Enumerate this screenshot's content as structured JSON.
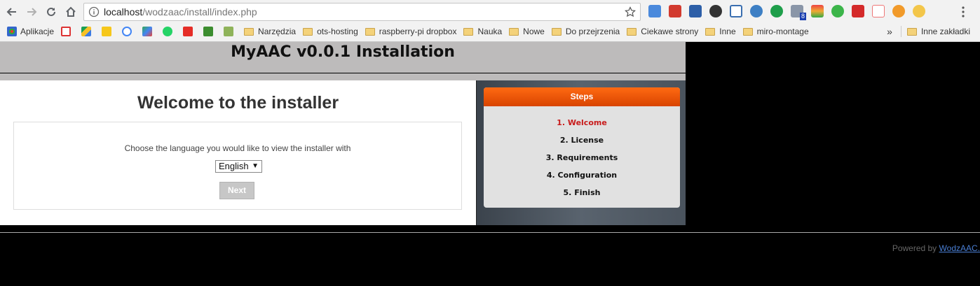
{
  "browser": {
    "url_host": "localhost",
    "url_path": "/wodzaac/install/index.php",
    "bookmarks": [
      {
        "label": "Aplikacje",
        "type": "apps"
      },
      {
        "label": "",
        "type": "gmail"
      },
      {
        "label": "",
        "type": "drive"
      },
      {
        "label": "",
        "type": "keep"
      },
      {
        "label": "",
        "type": "google"
      },
      {
        "label": "",
        "type": "maps"
      },
      {
        "label": "",
        "type": "whatsapp"
      },
      {
        "label": "",
        "type": "youtube"
      },
      {
        "label": "",
        "type": "feedly"
      },
      {
        "label": "",
        "type": "evernote"
      },
      {
        "label": "Narzędzia",
        "type": "folder"
      },
      {
        "label": "ots-hosting",
        "type": "folder"
      },
      {
        "label": "raspberry-pi dropbox",
        "type": "folder"
      },
      {
        "label": "Nauka",
        "type": "folder"
      },
      {
        "label": "Nowe",
        "type": "folder"
      },
      {
        "label": "Do przejrzenia",
        "type": "folder"
      },
      {
        "label": "Ciekawe strony",
        "type": "folder"
      },
      {
        "label": "Inne",
        "type": "folder"
      },
      {
        "label": "miro-montage",
        "type": "folder"
      }
    ],
    "more": "»",
    "other_bookmarks": "Inne zakładki",
    "ext_badge": "8"
  },
  "page": {
    "title": "MyAAC v0.0.1 Installation",
    "heading": "Welcome to the installer",
    "prompt": "Choose the language you would like to view the installer with",
    "language_selected": "English",
    "next_label": "Next",
    "steps_title": "Steps",
    "steps": [
      {
        "label": "1. Welcome",
        "active": true
      },
      {
        "label": "2. License",
        "active": false
      },
      {
        "label": "3. Requirements",
        "active": false
      },
      {
        "label": "4. Configuration",
        "active": false
      },
      {
        "label": "5. Finish",
        "active": false
      }
    ],
    "powered_prefix": "Powered by",
    "powered_link": "WodzAAC."
  },
  "colors": {
    "accent_orange": "#ff6a12",
    "active_step": "#c81b1b",
    "link": "#4a7fd4"
  }
}
